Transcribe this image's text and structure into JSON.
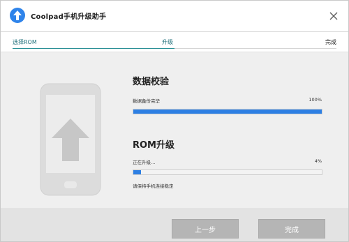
{
  "window": {
    "title": "Coolpad手机升级助手",
    "close_icon": "close-icon",
    "logo_icon": "up-arrow-logo-icon",
    "accent_color": "#2f84ea"
  },
  "steps": {
    "items": [
      {
        "label": "选择ROM"
      },
      {
        "label": "升级"
      },
      {
        "label": "完成"
      }
    ],
    "active_index": 1,
    "active_color": "#2a8f96"
  },
  "illustration": {
    "icon": "phone-upgrade-icon"
  },
  "data_check": {
    "title": "数据校验",
    "status": "数据备份完毕",
    "percent_label": "100%",
    "progress": 1.0
  },
  "rom_upgrade": {
    "title": "ROM升级",
    "status": "正在升级…",
    "percent_label": "4%",
    "progress": 0.04,
    "note": "请保持手机连接稳定"
  },
  "footer": {
    "prev_label": "上一步",
    "done_label": "完成"
  }
}
